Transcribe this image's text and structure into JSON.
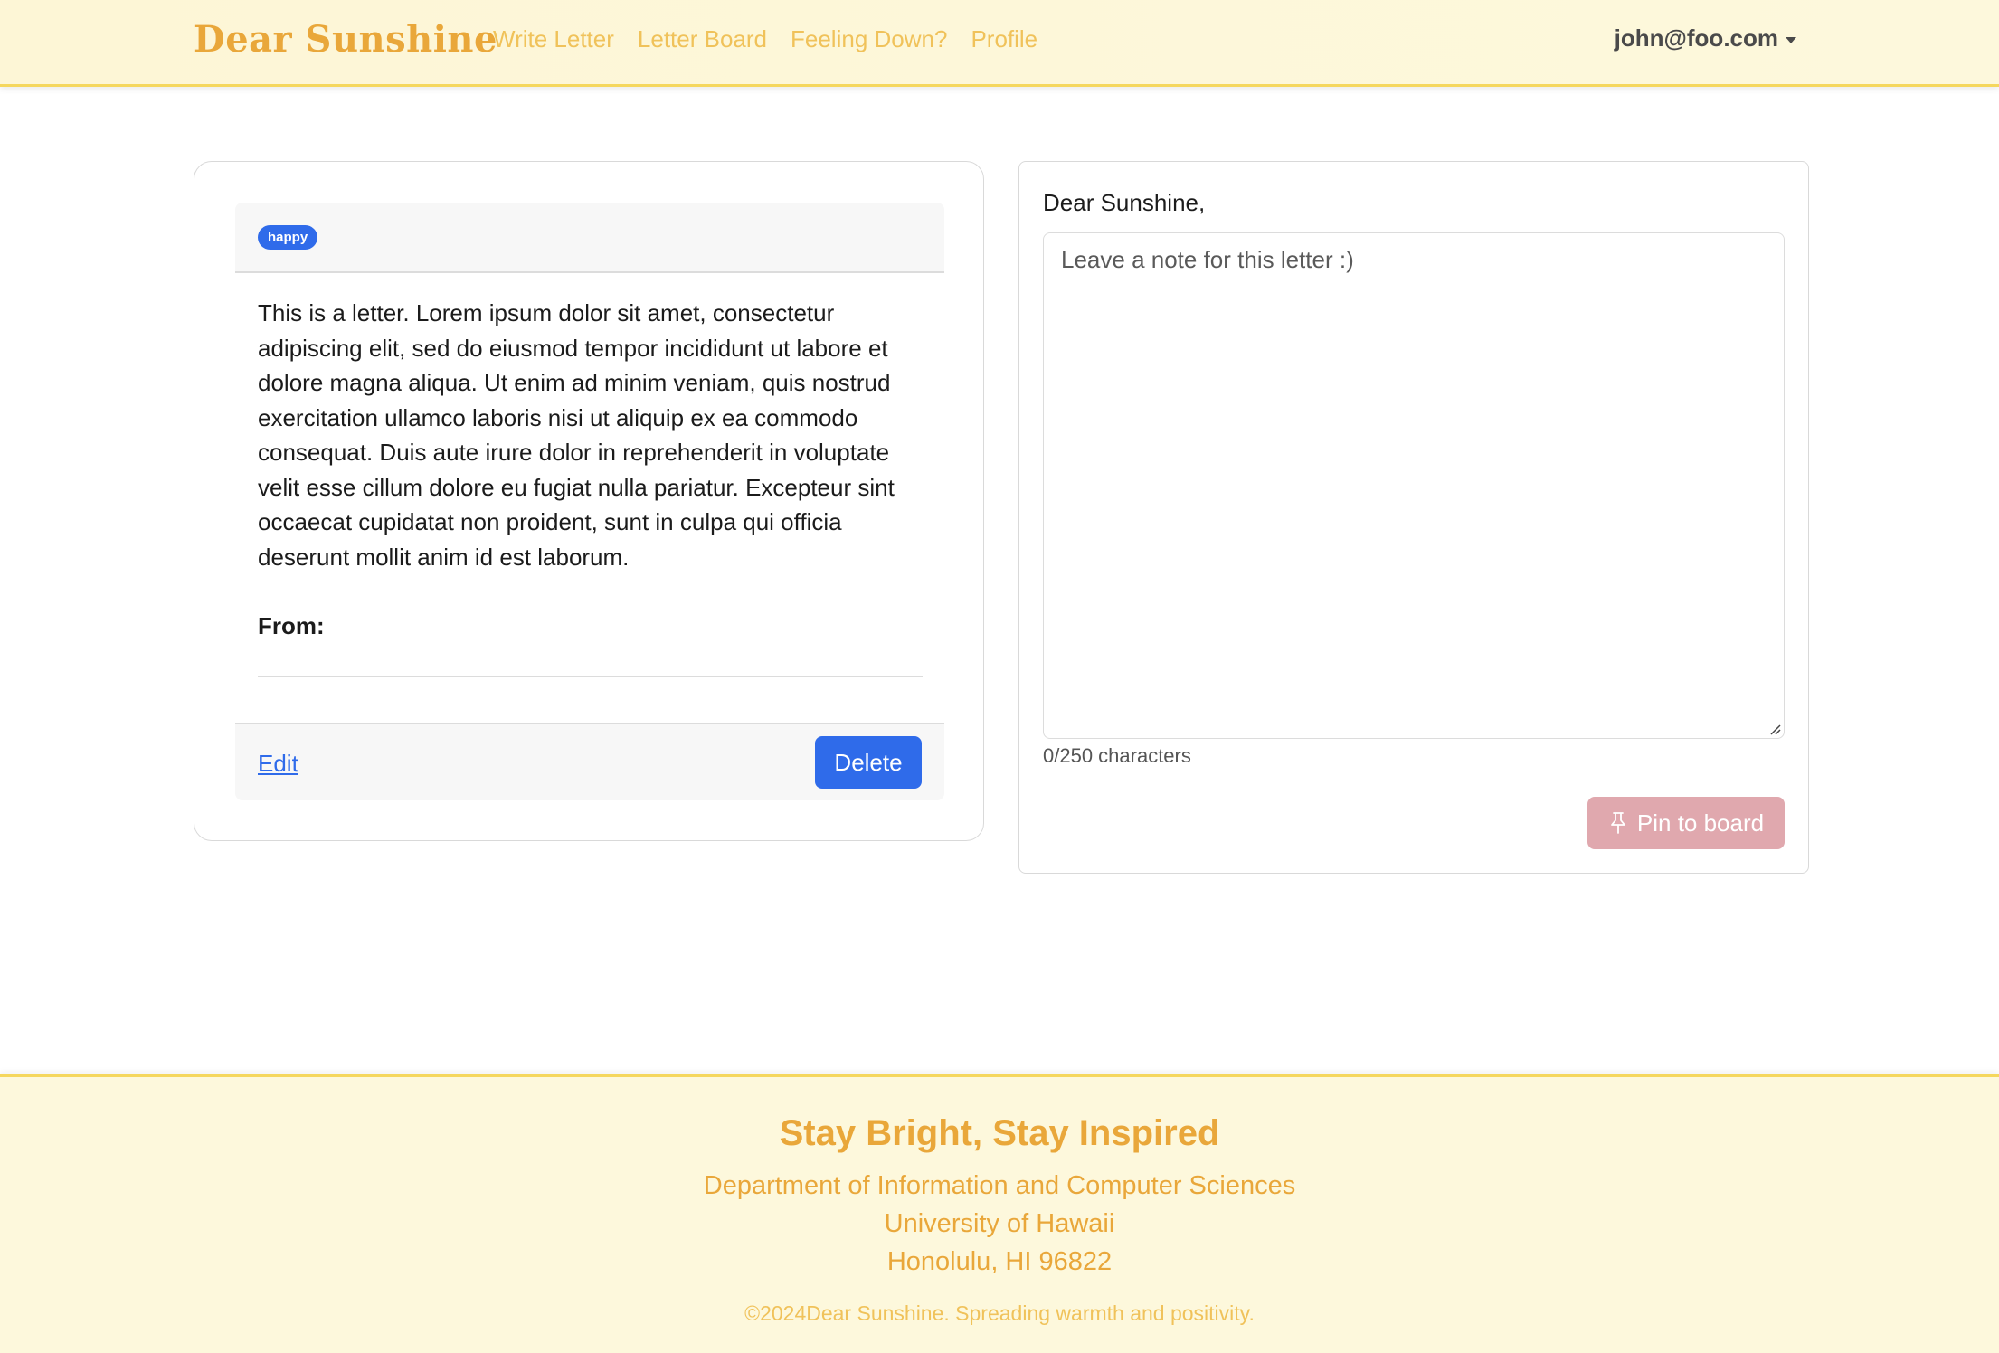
{
  "nav": {
    "brand": "Dear Sunshine",
    "links": [
      "Write Letter",
      "Letter Board",
      "Feeling Down?",
      "Profile"
    ],
    "user": "john@foo.com"
  },
  "letter": {
    "tag": "happy",
    "body": "This is a letter. Lorem ipsum dolor sit amet, consectetur adipiscing elit, sed do eiusmod tempor incididunt ut labore et dolore magna aliqua. Ut enim ad minim veniam, quis nostrud exercitation ullamco laboris nisi ut aliquip ex ea commodo consequat. Duis aute irure dolor in reprehenderit in voluptate velit esse cillum dolore eu fugiat nulla pariatur. Excepteur sint occaecat cupidatat non proident, sunt in culpa qui officia deserunt mollit anim id est laborum.",
    "from_label": "From:",
    "edit_label": "Edit",
    "delete_label": "Delete"
  },
  "note": {
    "greeting": "Dear Sunshine,",
    "placeholder": "Leave a note for this letter :)",
    "char_count": "0/250 characters",
    "pin_label": "Pin to board"
  },
  "footer": {
    "title": "Stay Bright, Stay Inspired",
    "lines": [
      "Department of Information and Computer Sciences",
      "University of Hawaii",
      "Honolulu, HI 96822"
    ],
    "copyright": "©2024Dear Sunshine. Spreading warmth and positivity."
  },
  "colors": {
    "brand": "#e9a73a",
    "nav_link": "#f0c25a",
    "primary": "#2f6bea",
    "pin_button": "#e0a8ae",
    "nav_background": "#fdf6d6"
  }
}
